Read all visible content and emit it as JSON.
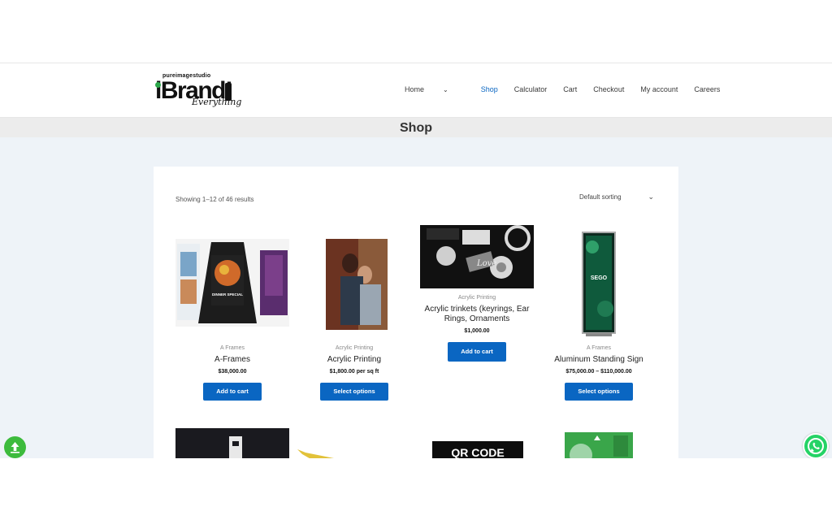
{
  "logo": {
    "small": "pureimagestudio",
    "big": "iBrand!",
    "script": "Everything"
  },
  "nav": [
    {
      "label": "Home",
      "dropdown": true
    },
    {
      "label": "Shop",
      "active": true
    },
    {
      "label": "Calculator"
    },
    {
      "label": "Cart"
    },
    {
      "label": "Checkout"
    },
    {
      "label": "My account"
    },
    {
      "label": "Careers"
    }
  ],
  "page_title": "Shop",
  "results_count": "Showing 1–12 of 46 results",
  "sorting": {
    "selected": "Default sorting"
  },
  "products": [
    {
      "category": "A Frames",
      "name": "A-Frames",
      "price": "$38,000.00",
      "button": "Add to cart"
    },
    {
      "category": "Acrylic Printing",
      "name": "Acrylic Printing",
      "price": "$1,800.00 per sq ft",
      "button": "Select options"
    },
    {
      "category": "Acrylic Printing",
      "name": "Acrylic trinkets (keyrings, Ear Rings, Ornaments",
      "price": "$1,000.00",
      "button": "Add to cart"
    },
    {
      "category": "A Frames",
      "name": "Aluminum Standing Sign",
      "price": "$75,000.00 – $110,000.00",
      "button": "Select options"
    }
  ],
  "next_row_text": "QR CODE",
  "image_text": {
    "aframe": "DINNER SPECIAL",
    "lightbox": "SEGO",
    "trinket": "Love"
  },
  "colors": {
    "accent": "#0a66c2",
    "whatsapp": "#25d366",
    "backtop": "#3dbb3d"
  }
}
